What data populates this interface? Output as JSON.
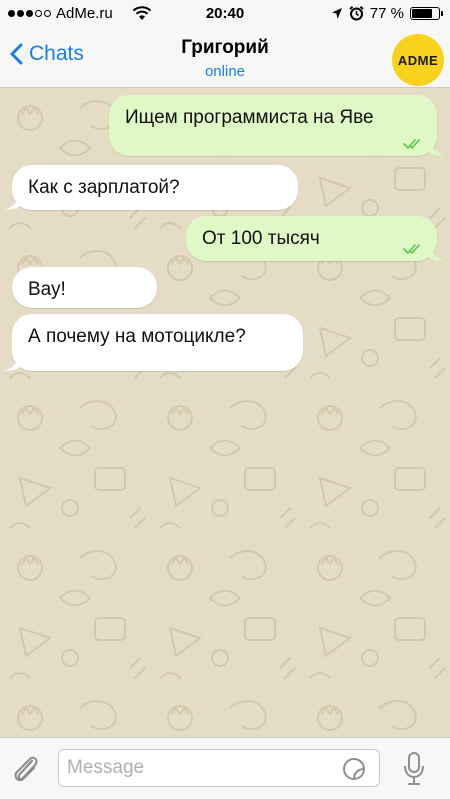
{
  "status_bar": {
    "carrier": "AdMe.ru",
    "time": "20:40",
    "battery": "77 %",
    "battery_level": 0.77
  },
  "header": {
    "back_label": "Chats",
    "contact_name": "Григорий",
    "contact_status": "online",
    "avatar_text": "ADME"
  },
  "messages": [
    {
      "direction": "out",
      "text": "Ищем программиста на Яве",
      "read": true
    },
    {
      "direction": "in",
      "text": "Как с зарплатой?"
    },
    {
      "direction": "out",
      "text": "От 100 тысяч",
      "read": true
    },
    {
      "direction": "in",
      "text": "Вау!"
    },
    {
      "direction": "in",
      "text": "А почему на мотоцикле?"
    }
  ],
  "input": {
    "placeholder": "Message",
    "value": ""
  },
  "colors": {
    "accent": "#1a7ee8",
    "outgoing_bubble": "#e0f8c6",
    "incoming_bubble": "#ffffff",
    "wallpaper": "#e5dcc5",
    "read_ticks": "#5dc452",
    "avatar": "#f9d21c"
  },
  "icons": {
    "back": "chevron-left-icon",
    "attach": "paperclip-icon",
    "sticker": "sticker-icon",
    "mic": "microphone-icon",
    "read": "double-check-icon"
  }
}
